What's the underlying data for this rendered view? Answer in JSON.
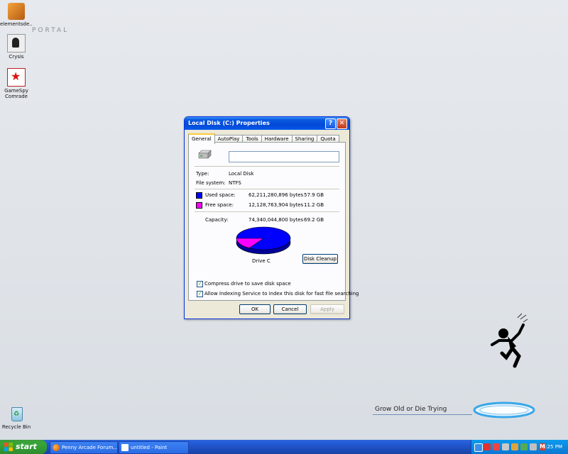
{
  "desktop": {
    "icons": [
      {
        "label": "elementsde..."
      },
      {
        "label": "Crysis"
      },
      {
        "label": "GameSpy Comrade"
      },
      {
        "label": "Recycle Bin"
      }
    ],
    "logo_text": "PORTAL",
    "motto": "Grow Old or Die Trying"
  },
  "dialog": {
    "title": "Local Disk (C:) Properties",
    "tabs": [
      "General",
      "AutoPlay",
      "Tools",
      "Hardware",
      "Sharing",
      "Quota"
    ],
    "active_tab": "General",
    "name_value": "",
    "type_label": "Type:",
    "type_value": "Local Disk",
    "fs_label": "File system:",
    "fs_value": "NTFS",
    "used_label": "Used space:",
    "used_bytes": "62,211,280,896 bytes",
    "used_gb": "57.9 GB",
    "free_label": "Free space:",
    "free_bytes": "12,128,763,904 bytes",
    "free_gb": "11.2 GB",
    "capacity_label": "Capacity:",
    "capacity_bytes": "74,340,044,800 bytes",
    "capacity_gb": "69.2 GB",
    "drive_label": "Drive C",
    "disk_cleanup": "Disk Cleanup",
    "compress_label": "Compress drive to save disk space",
    "compress_checked": true,
    "index_label": "Allow Indexing Service to index this disk for fast file searching",
    "index_checked": true,
    "ok": "OK",
    "cancel": "Cancel",
    "apply": "Apply",
    "colors": {
      "used": "#0000ff",
      "free": "#ff00ff"
    },
    "used_fraction": 0.837
  },
  "taskbar": {
    "start": "start",
    "tasks": [
      "Penny Arcade Forum...",
      "untitled - Paint"
    ],
    "clock": "5:25 PM"
  }
}
